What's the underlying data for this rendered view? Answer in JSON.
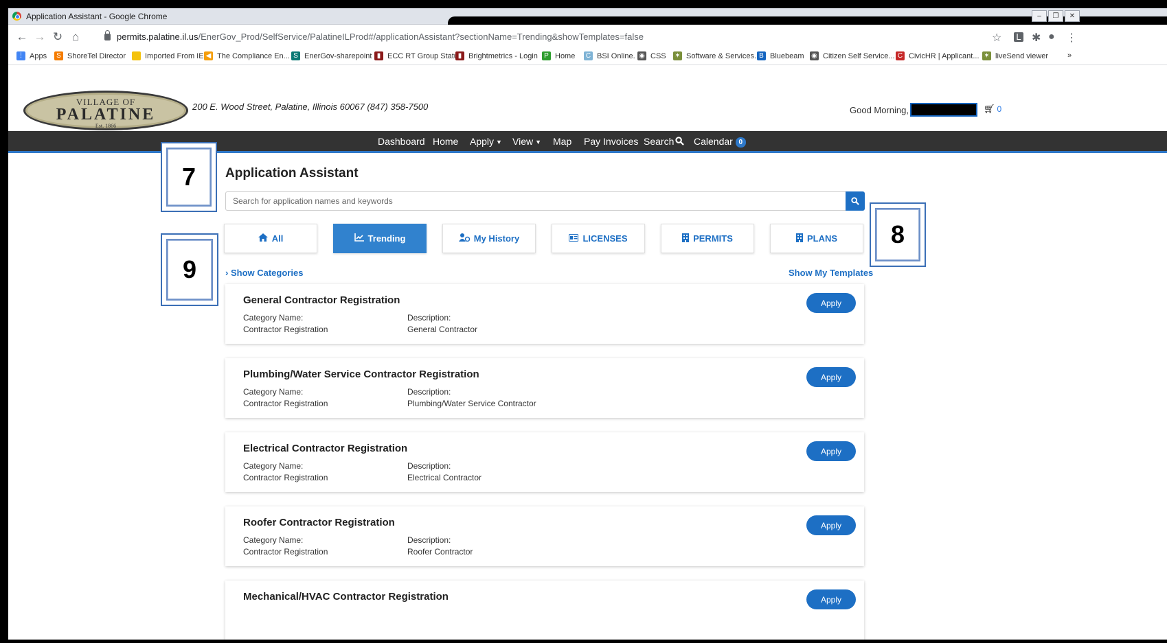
{
  "browser": {
    "window_title": "Application Assistant - Google Chrome",
    "url_host": "permits.palatine.il.us",
    "url_path": "/EnerGov_Prod/SelfService/PalatineILProd#/applicationAssistant?sectionName=Trending&showTemplates=false",
    "bookmarks": [
      {
        "label": "Apps",
        "icon": "apps-grid-icon",
        "color": "#4285f4"
      },
      {
        "label": "ShoreTel Director",
        "icon": "shoretel-icon",
        "color": "#f57c00"
      },
      {
        "label": "Imported From IE",
        "icon": "folder-icon",
        "color": "#f4c20d"
      },
      {
        "label": "The Compliance En...",
        "icon": "compliance-icon",
        "color": "#f59e0b"
      },
      {
        "label": "EnerGov-sharepoint",
        "icon": "sharepoint-icon",
        "color": "#0b7a75"
      },
      {
        "label": "ECC RT Group Status",
        "icon": "bars-icon",
        "color": "#8b1a1a"
      },
      {
        "label": "Brightmetrics - Login",
        "icon": "bars-icon",
        "color": "#8b1a1a"
      },
      {
        "label": "Home",
        "icon": "home-page-icon",
        "color": "#2e9e2e"
      },
      {
        "label": "BSI Online.",
        "icon": "bsi-icon",
        "color": "#7fb3d5"
      },
      {
        "label": "CSS",
        "icon": "globe-icon",
        "color": "#555555"
      },
      {
        "label": "Software & Services...",
        "icon": "software-icon",
        "color": "#7a8f3a"
      },
      {
        "label": "Bluebeam",
        "icon": "bluebeam-icon",
        "color": "#1565c0"
      },
      {
        "label": "Citizen Self Service...",
        "icon": "globe-icon",
        "color": "#555555"
      },
      {
        "label": "CivicHR | Applicant...",
        "icon": "civichr-icon",
        "color": "#c62828"
      },
      {
        "label": "liveSend viewer",
        "icon": "software-icon",
        "color": "#7a8f3a"
      }
    ],
    "more_bookmarks": "»"
  },
  "header": {
    "logo_top": "VILLAGE OF",
    "logo_main": "PALATINE",
    "logo_est": "Est. 1866",
    "address": "200 E. Wood Street, Palatine, Illinois 60067  (847) 358-7500",
    "greeting": "Good Morning,",
    "cart_count": "0"
  },
  "nav": {
    "items": [
      "Dashboard",
      "Home",
      "Apply",
      "View",
      "Map",
      "Pay Invoices",
      "Search",
      "Calendar"
    ],
    "calendar_badge": "0"
  },
  "main": {
    "title": "Application Assistant",
    "search_placeholder": "Search for application names and keywords",
    "tabs": [
      {
        "label": "All",
        "icon": "home-icon"
      },
      {
        "label": "Trending",
        "icon": "trending-chart-icon",
        "active": true
      },
      {
        "label": "My History",
        "icon": "user-history-icon"
      },
      {
        "label": "LICENSES",
        "icon": "id-card-icon"
      },
      {
        "label": "PERMITS",
        "icon": "building-icon"
      },
      {
        "label": "PLANS",
        "icon": "building-icon"
      }
    ],
    "show_categories": "Show Categories",
    "show_templates": "Show My Templates",
    "category_label": "Category Name:",
    "description_label": "Description:",
    "apply_label": "Apply",
    "cards": [
      {
        "title": "General Contractor Registration",
        "category": "Contractor Registration",
        "description": "General Contractor"
      },
      {
        "title": "Plumbing/Water Service Contractor Registration",
        "category": "Contractor Registration",
        "description": "Plumbing/Water Service Contractor"
      },
      {
        "title": "Electrical Contractor Registration",
        "category": "Contractor Registration",
        "description": "Electrical Contractor"
      },
      {
        "title": "Roofer Contractor Registration",
        "category": "Contractor Registration",
        "description": "Roofer Contractor"
      },
      {
        "title": "Mechanical/HVAC Contractor Registration",
        "category": "",
        "description": ""
      }
    ]
  },
  "annotations": [
    "7",
    "8",
    "9"
  ],
  "colors": {
    "accent": "#1d6fc4",
    "active_tab": "#3182ce",
    "nav_bg": "#333333"
  }
}
